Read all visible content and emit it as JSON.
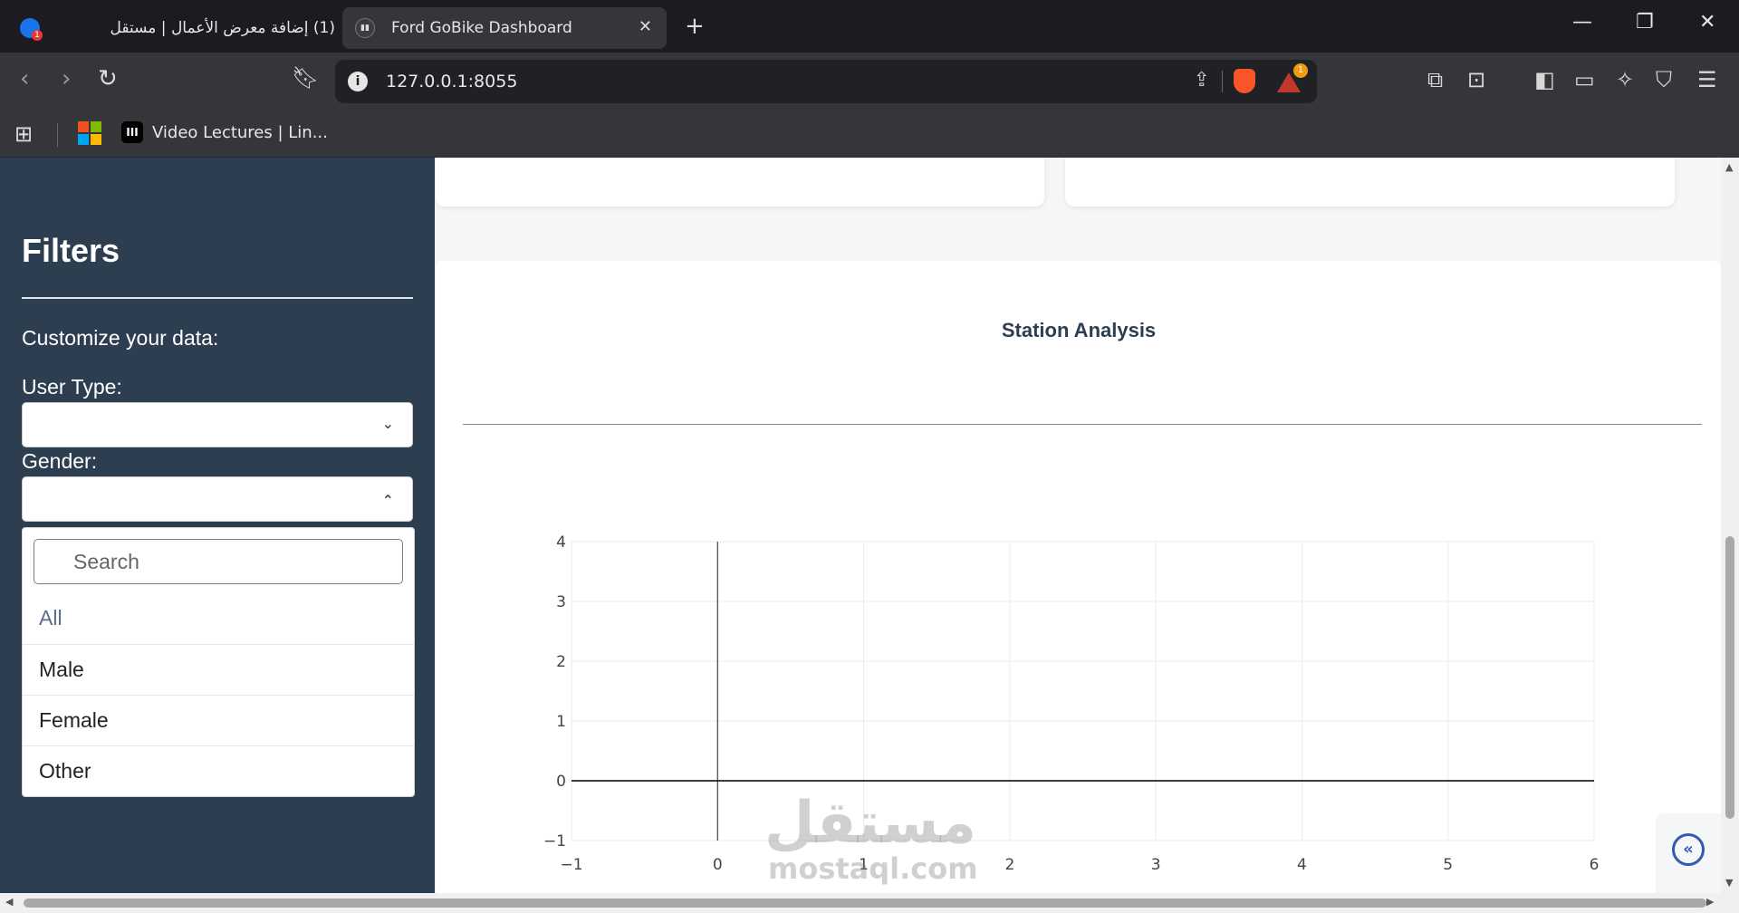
{
  "browser": {
    "tabs": [
      {
        "title": "(1) إضافة معرض الأعمال | مستقل",
        "active": false
      },
      {
        "title": "Ford GoBike Dashboard",
        "active": true
      }
    ],
    "url": "127.0.0.1:8055",
    "notification_count": "1",
    "bookmark_label": "Video Lectures | Lin..."
  },
  "sidebar": {
    "title": "Filters",
    "subtitle": "Customize your data:",
    "user_type_label": "User Type:",
    "gender_label": "Gender:",
    "gender_menu": {
      "search_placeholder": "Search",
      "options": [
        "All",
        "Male",
        "Female",
        "Other"
      ]
    }
  },
  "panel": {
    "title": "Station Analysis"
  },
  "chart_data": {
    "type": "scatter",
    "title": "",
    "xlabel": "",
    "ylabel": "",
    "xlim": [
      -1,
      6
    ],
    "ylim": [
      -1,
      4
    ],
    "x_ticks": [
      "−1",
      "0",
      "1",
      "2",
      "3",
      "4",
      "5",
      "6"
    ],
    "y_ticks": [
      "−1",
      "0",
      "1",
      "2",
      "3",
      "4"
    ],
    "series": [],
    "grid": true
  },
  "watermark": {
    "arabic": "مستقل",
    "latin": "mostaql.com"
  },
  "colors": {
    "sidebar_bg": "#2c3e50",
    "page_bg": "#f4f6f8",
    "accent": "#2f5bb0"
  }
}
